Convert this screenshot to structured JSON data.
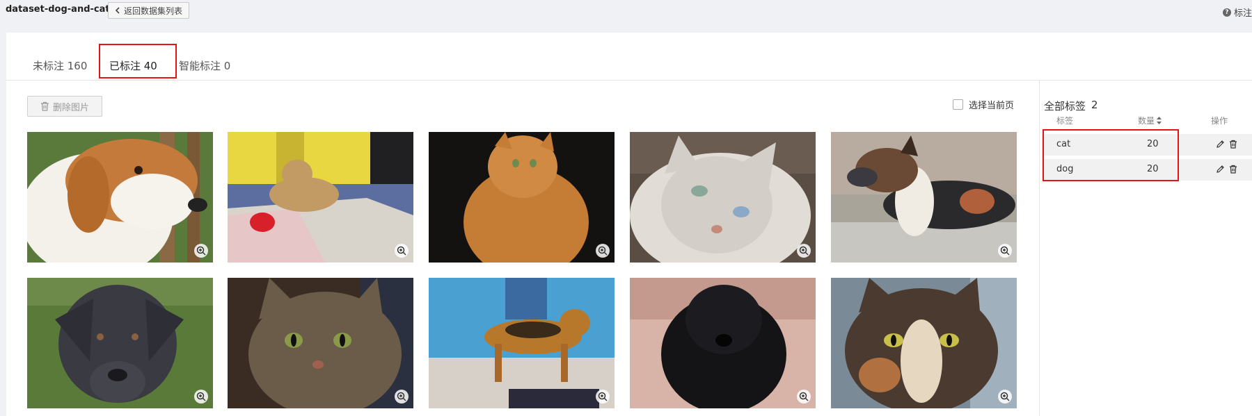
{
  "header": {
    "dataset_name": "dataset-dog-and-cat",
    "back_label": "返回数据集列表",
    "help_label": "标注"
  },
  "tabs": [
    {
      "label": "未标注 160"
    },
    {
      "label": "已标注 40"
    },
    {
      "label": "智能标注 0"
    }
  ],
  "toolbar": {
    "delete_label": "删除图片",
    "select_page_label": "选择当前页"
  },
  "images": [
    {
      "alt": "dog"
    },
    {
      "alt": "dog"
    },
    {
      "alt": "cat"
    },
    {
      "alt": "cat"
    },
    {
      "alt": "dog"
    },
    {
      "alt": "dog"
    },
    {
      "alt": "cat"
    },
    {
      "alt": "dog"
    },
    {
      "alt": "dog"
    },
    {
      "alt": "cat"
    }
  ],
  "sidebar": {
    "title": "全部标签",
    "count": "2",
    "col_label": "标签",
    "col_count": "数量",
    "col_ops": "操作",
    "labels": [
      {
        "name": "cat",
        "count": "20"
      },
      {
        "name": "dog",
        "count": "20"
      }
    ]
  },
  "colors": {
    "accent": "#3d82f0",
    "highlight": "#e51414"
  }
}
